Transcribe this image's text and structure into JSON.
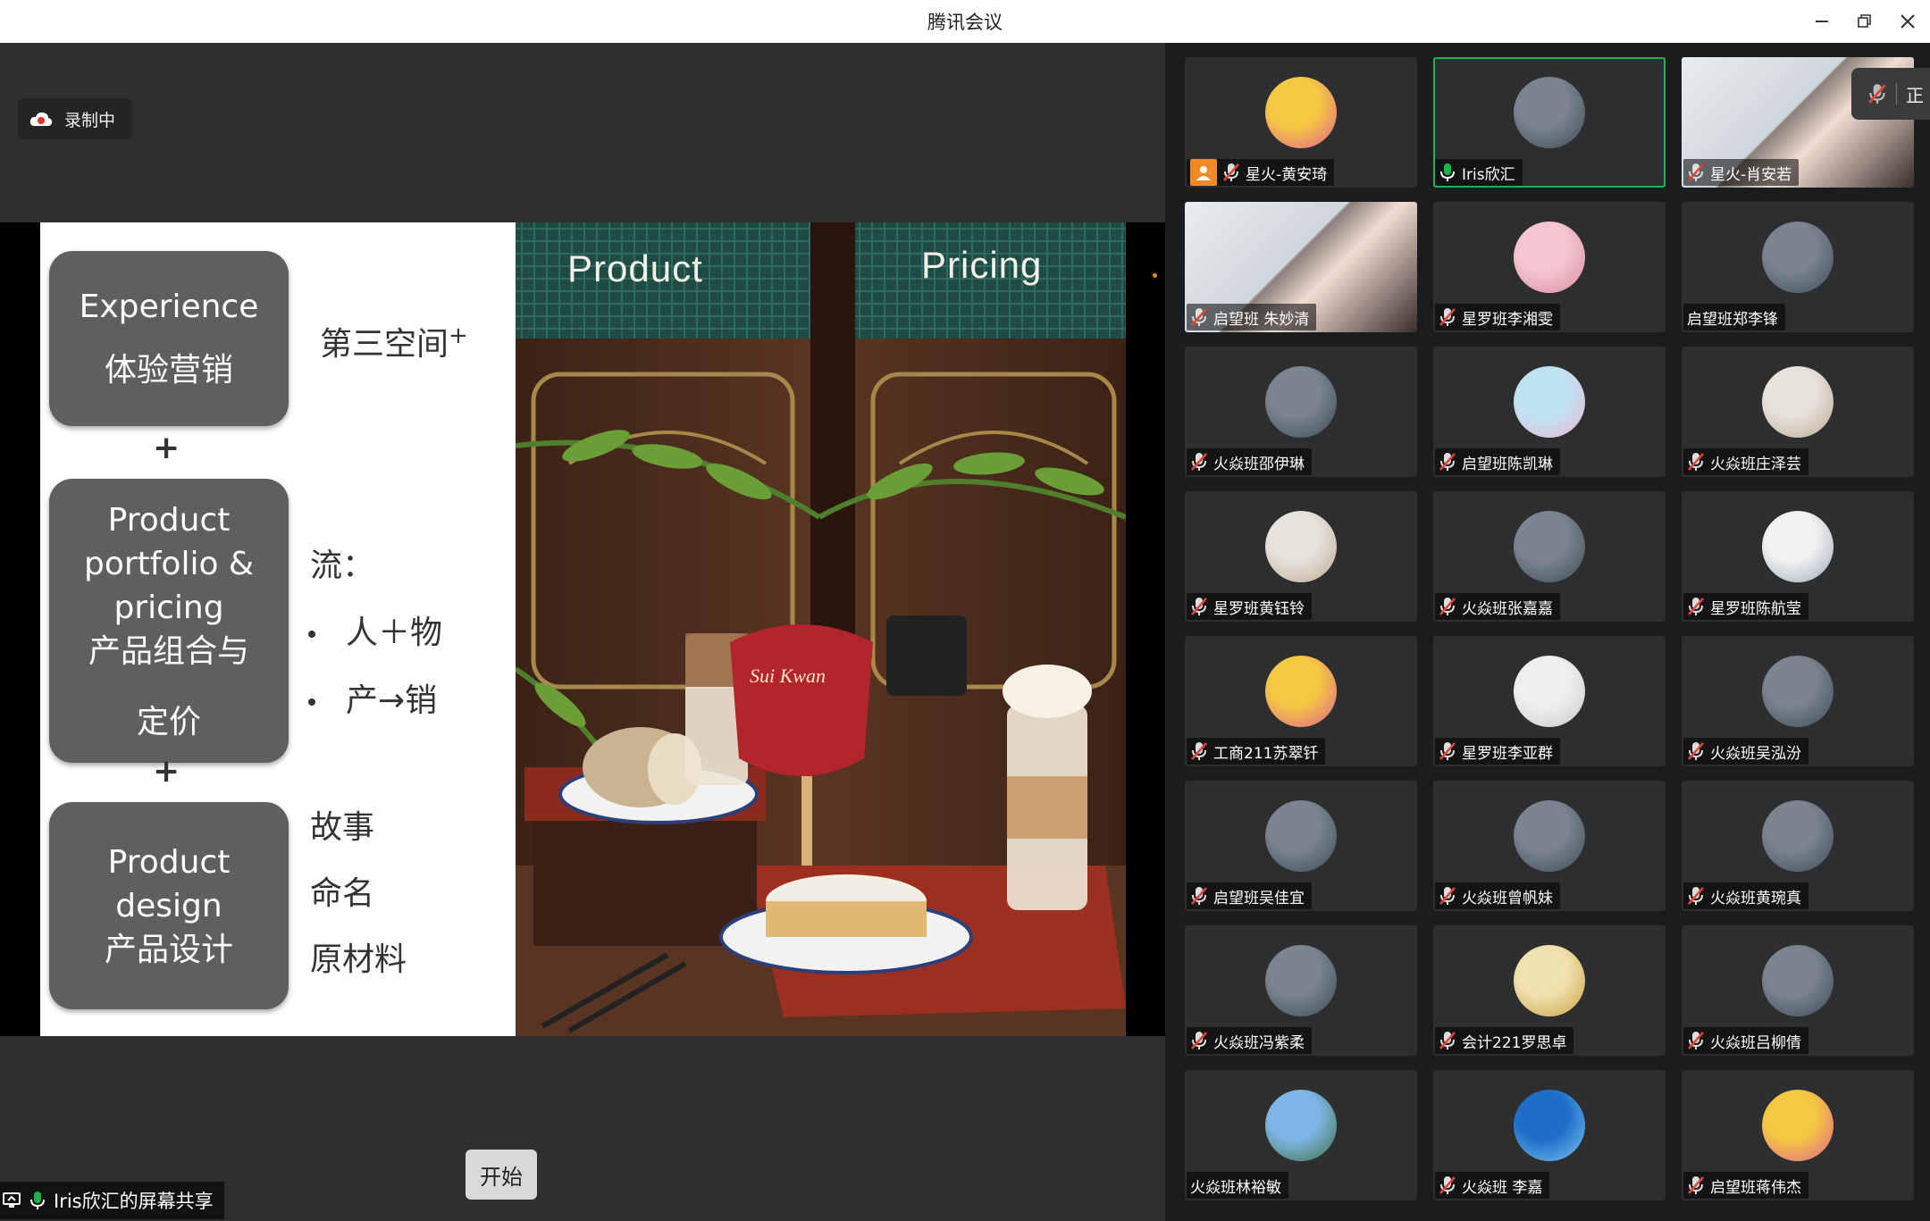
{
  "window": {
    "title": "腾讯会议"
  },
  "recording": {
    "label": "录制中"
  },
  "slide": {
    "box1": {
      "en": "Experience",
      "zh": "体验营销"
    },
    "box2": {
      "en1": "Product",
      "en2": "portfolio &",
      "en3": "pricing",
      "zh1": "产品组合与",
      "zh2": "定价"
    },
    "box3": {
      "en1": "Product",
      "en2": "design",
      "zh": "产品设计"
    },
    "plus": "+",
    "third_space": "第三空间",
    "third_space_sup": "+",
    "flow_label": "流：",
    "bullets": [
      "人＋物",
      "产→销"
    ],
    "design_items": [
      "故事",
      "命名",
      "原材料"
    ],
    "photo_labels": {
      "product": "Product",
      "pricing": "Pricing"
    },
    "sign_text": "Sui Kwan"
  },
  "controls": {
    "start_label": "开始"
  },
  "share_bar": {
    "label": "Iris欣汇的屏幕共享"
  },
  "mute_popup": {
    "text": "正"
  },
  "participants": [
    {
      "name": "星火-黄安琦",
      "mic": "muted",
      "host": true,
      "avatar": "cartoon-avatar"
    },
    {
      "name": "Iris欣汇",
      "mic": "active",
      "active": true,
      "avatar": "photo-avatar"
    },
    {
      "name": "星火-肖安若",
      "mic": "muted",
      "video": true
    },
    {
      "name": "启望班 朱妙清",
      "mic": "muted",
      "video": true
    },
    {
      "name": "星罗班李湘雯",
      "mic": "muted",
      "avatar": "baby-avatar"
    },
    {
      "name": "启望班郑李锋",
      "mic": "none",
      "avatar": "photo-avatar"
    },
    {
      "name": "火焱班邵伊琳",
      "mic": "muted",
      "avatar": "photo-avatar"
    },
    {
      "name": "启望班陈凯琳",
      "mic": "muted",
      "avatar": "anime-avatar"
    },
    {
      "name": "火焱班庄泽芸",
      "mic": "muted",
      "avatar": "cat-avatar"
    },
    {
      "name": "星罗班黄钰铃",
      "mic": "muted",
      "avatar": "cat-avatar"
    },
    {
      "name": "火焱班张嘉嘉",
      "mic": "muted",
      "avatar": "photo-avatar"
    },
    {
      "name": "星罗班陈航莹",
      "mic": "muted",
      "avatar": "dog-avatar"
    },
    {
      "name": "工商211苏翠钎",
      "mic": "muted",
      "avatar": "cartoon-avatar"
    },
    {
      "name": "星罗班李亚群",
      "mic": "muted",
      "avatar": "feather-avatar"
    },
    {
      "name": "火焱班吴泓汾",
      "mic": "muted",
      "avatar": "photo-avatar"
    },
    {
      "name": "启望班吴佳宜",
      "mic": "muted",
      "avatar": "photo-avatar"
    },
    {
      "name": "火焱班曾帆妹",
      "mic": "muted",
      "avatar": "photo-avatar"
    },
    {
      "name": "火焱班黄琬真",
      "mic": "muted",
      "avatar": "photo-avatar"
    },
    {
      "name": "火焱班冯紫柔",
      "mic": "muted",
      "avatar": "photo-avatar"
    },
    {
      "name": "会计221罗思卓",
      "mic": "muted",
      "avatar": "pikachu-avatar"
    },
    {
      "name": "火焱班吕柳倩",
      "mic": "muted",
      "avatar": "photo-avatar"
    },
    {
      "name": "火焱班林裕敏",
      "mic": "none",
      "avatar": "sky-avatar"
    },
    {
      "name": "火焱班 李嘉",
      "mic": "muted",
      "avatar": "lake-avatar"
    },
    {
      "name": "启望班蒋伟杰",
      "mic": "muted",
      "avatar": "cartoon-avatar"
    }
  ],
  "colors": {
    "active_border": "#1db34d",
    "muted_icon": "#e0463a",
    "active_mic": "#1db34d",
    "host_icon": "#f08a24"
  }
}
